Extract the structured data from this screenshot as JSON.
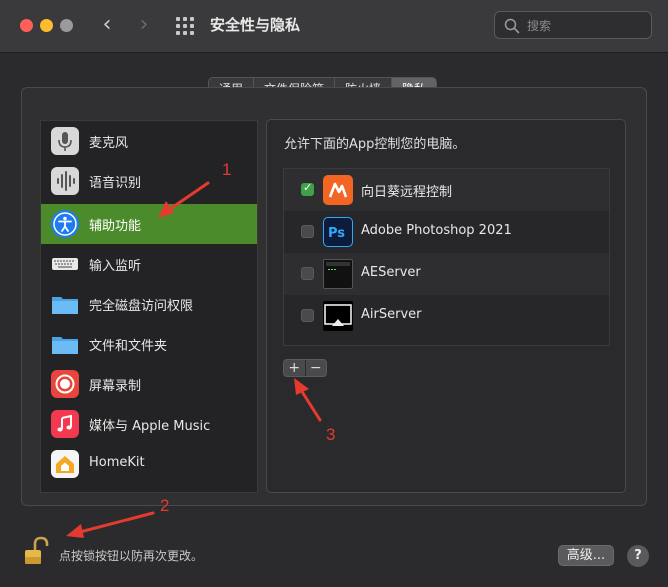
{
  "window": {
    "title": "安全性与隐私"
  },
  "search": {
    "placeholder": "搜索"
  },
  "tabs": [
    {
      "label": "通用",
      "active": false
    },
    {
      "label": "文件保险箱",
      "active": false
    },
    {
      "label": "防火墙",
      "active": false
    },
    {
      "label": "隐私",
      "active": true
    }
  ],
  "sidebar": {
    "items": [
      {
        "label": "麦克风",
        "icon": "microphone-icon",
        "selected": false
      },
      {
        "label": "语音识别",
        "icon": "waveform-icon",
        "selected": false
      },
      {
        "label": "辅助功能",
        "icon": "accessibility-icon",
        "selected": true
      },
      {
        "label": "输入监听",
        "icon": "keyboard-icon",
        "selected": false
      },
      {
        "label": "完全磁盘访问权限",
        "icon": "folder-icon",
        "selected": false
      },
      {
        "label": "文件和文件夹",
        "icon": "folder-icon",
        "selected": false
      },
      {
        "label": "屏幕录制",
        "icon": "screen-record-icon",
        "selected": false
      },
      {
        "label": "媒体与 Apple Music",
        "icon": "music-icon",
        "selected": false
      },
      {
        "label": "HomeKit",
        "icon": "home-icon",
        "selected": false
      }
    ]
  },
  "content": {
    "heading": "允许下面的App控制您的电脑。",
    "apps": [
      {
        "label": "向日葵远程控制",
        "checked": true,
        "icon": "sunlogin-icon"
      },
      {
        "label": "Adobe Photoshop 2021",
        "checked": false,
        "icon": "photoshop-icon"
      },
      {
        "label": "AEServer",
        "checked": false,
        "icon": "terminal-icon"
      },
      {
        "label": "AirServer",
        "checked": false,
        "icon": "airserver-icon"
      }
    ],
    "add_label": "+",
    "remove_label": "−"
  },
  "footer": {
    "lock_text": "点按锁按钮以防再次更改。",
    "advanced_label": "高级...",
    "help_label": "?"
  },
  "annotations": [
    "1",
    "2",
    "3"
  ],
  "colors": {
    "selection": "#4b8b2c",
    "annotation": "#e53a2f",
    "checkbox_on": "#3fa24b"
  }
}
